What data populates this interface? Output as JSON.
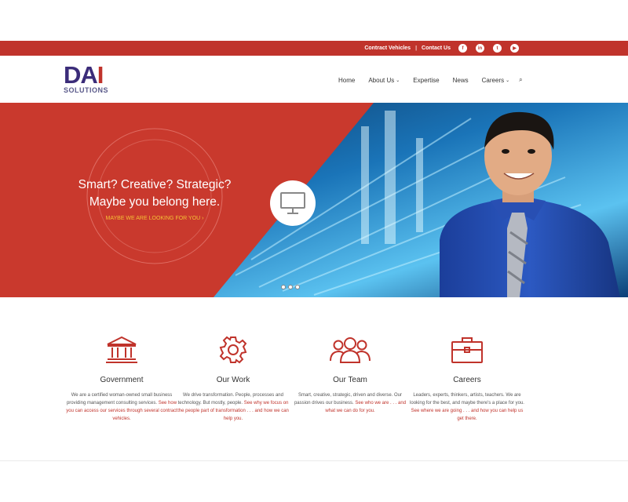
{
  "topbar": {
    "links": [
      "Contract Vehicles",
      "Contact Us"
    ],
    "social_icons": [
      "facebook-icon",
      "linkedin-icon",
      "twitter-icon",
      "youtube-icon"
    ],
    "social_glyphs": [
      "f",
      "in",
      "t",
      "▶"
    ]
  },
  "header": {
    "logo_mark": "DA",
    "logo_mark_i": "I",
    "logo_sub": "SOLUTIONS",
    "nav": [
      {
        "label": "Home",
        "has_dropdown": false
      },
      {
        "label": "About Us",
        "has_dropdown": true
      },
      {
        "label": "Expertise",
        "has_dropdown": false
      },
      {
        "label": "News",
        "has_dropdown": false
      },
      {
        "label": "Careers",
        "has_dropdown": true
      }
    ],
    "search_glyph": "⌕"
  },
  "hero": {
    "line1": "Smart? Creative? Strategic?",
    "line2": "Maybe you belong here.",
    "link": "MAYBE WE ARE LOOKING FOR YOU ›",
    "badge_icon": "monitor-icon",
    "slide_count": 3,
    "active_slide": 1
  },
  "features": [
    {
      "icon": "government-building-icon",
      "title": "Government",
      "text": "We are a certified woman-owned small business providing management consulting services. ",
      "link": "See how you can access our services through several contract vehicles."
    },
    {
      "icon": "gear-icon",
      "title": "Our Work",
      "text": "We drive transformation. People, processes and technology. But mostly, people. ",
      "link": "See why we focus on the people part of transformation . . . and how we can help you."
    },
    {
      "icon": "team-people-icon",
      "title": "Our Team",
      "text": "Smart, creative, strategic, driven and diverse. Our passion drives our business. ",
      "link": "See who we are . . . and what we can do for you."
    },
    {
      "icon": "briefcase-icon",
      "title": "Careers",
      "text": "Leaders, experts, thinkers, artists, teachers. We are looking for the best, and maybe there's a place for you. ",
      "link": "See where we are going . . . and how you can help us get there."
    }
  ],
  "colors": {
    "brand_red": "#c0332b",
    "brand_purple": "#3b2c79",
    "hero_link": "#f5c035"
  }
}
